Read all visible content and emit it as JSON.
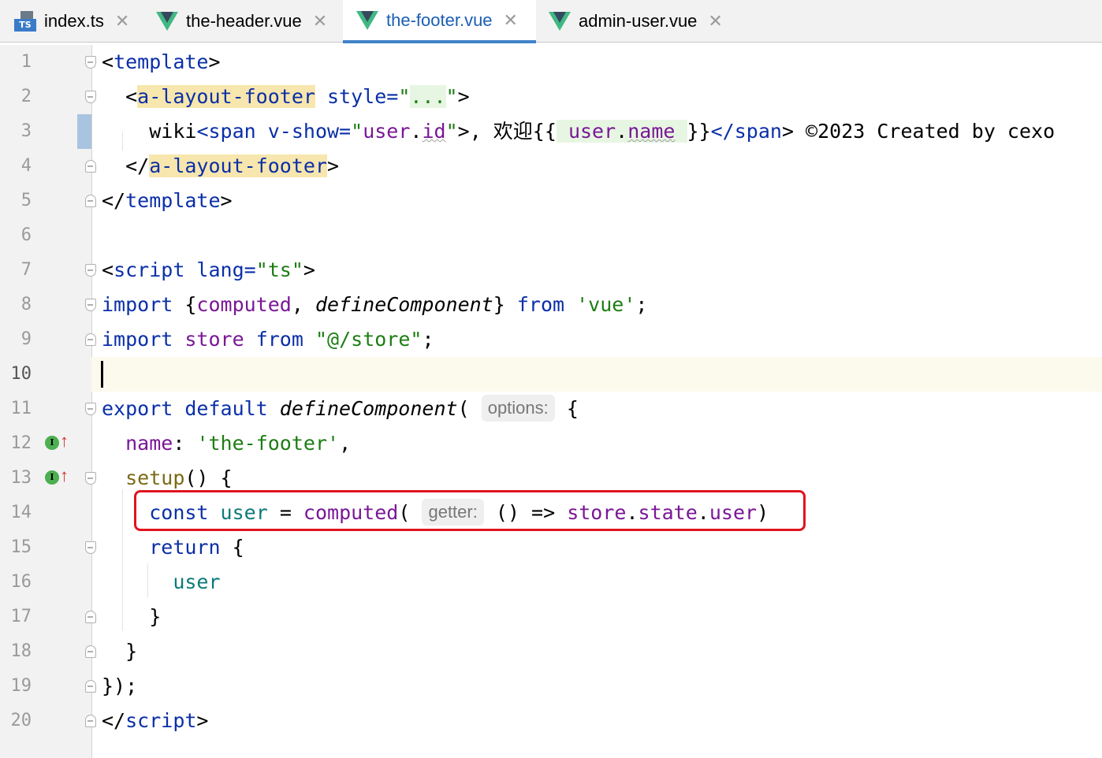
{
  "tabs": [
    {
      "label": "index.ts",
      "icon": "typescript-file-icon",
      "active": false
    },
    {
      "label": "the-header.vue",
      "icon": "vue-file-icon",
      "active": false
    },
    {
      "label": "the-footer.vue",
      "icon": "vue-file-icon",
      "active": true
    },
    {
      "label": "admin-user.vue",
      "icon": "vue-file-icon",
      "active": false
    }
  ],
  "tab_close_glyph": "✕",
  "ts_icon_text": "TS",
  "line_numbers": [
    "1",
    "2",
    "3",
    "4",
    "5",
    "6",
    "7",
    "8",
    "9",
    "10",
    "11",
    "12",
    "13",
    "14",
    "15",
    "16",
    "17",
    "18",
    "19",
    "20"
  ],
  "current_line": 10,
  "colors": {
    "vue_green": "#41b883",
    "accent_blue": "#4083c9",
    "highlight_box": "#e0141e"
  },
  "code": {
    "l1": {
      "t1": "<",
      "t2": "template",
      "t3": ">"
    },
    "l2": {
      "t1": "<",
      "t2": "a-layout-footer",
      "t3": " style=",
      "t4": "\"",
      "t5": "...",
      "t6": "\"",
      "t7": ">"
    },
    "l3": {
      "t1": "wiki",
      "t2": "<span",
      "t3": " v-show=",
      "t4": "\"",
      "t5": "user",
      "t6": ".",
      "t7": "id",
      "t8": "\"",
      "t9": ">, 欢迎{{",
      "t10": " user",
      "t11": ".",
      "t12": "name",
      "t13": " ",
      "t14": "}}",
      "t15": "</span",
      "t16": ">",
      "t17": " ©2023 Created by cexo"
    },
    "l4": {
      "t1": "</",
      "t2": "a-layout-footer",
      "t3": ">"
    },
    "l5": {
      "t1": "</",
      "t2": "template",
      "t3": ">"
    },
    "l7": {
      "t1": "<",
      "t2": "script",
      "t3": " lang=",
      "t4": "\"ts\"",
      "t5": ">"
    },
    "l8": {
      "t1": "import",
      "t2": " {",
      "t3": "computed",
      "t4": ", ",
      "t5": "defineComponent",
      "t6": "} ",
      "t7": "from",
      "t8": " ",
      "t9": "'vue'",
      "t10": ";"
    },
    "l9": {
      "t1": "import",
      "t2": " ",
      "t3": "store",
      "t4": " ",
      "t5": "from",
      "t6": " ",
      "t7": "\"@/store\"",
      "t8": ";"
    },
    "l11": {
      "t1": "export",
      "t2": " ",
      "t3": "default",
      "t4": " ",
      "t5": "defineComponent",
      "t6": "(",
      "hint": "options:",
      "t7": " {"
    },
    "l12": {
      "t1": "name",
      "t2": ": ",
      "t3": "'the-footer'",
      "t4": ","
    },
    "l13": {
      "t1": "setup",
      "t2": "() {"
    },
    "l14": {
      "t1": "const",
      "t2": " ",
      "t3": "user",
      "t4": " = ",
      "t5": "computed",
      "t6": "(",
      "hint": "getter:",
      "t7": " () => ",
      "t8": "store",
      "t9": ".",
      "t10": "state",
      "t11": ".",
      "t12": "user",
      "t13": ")"
    },
    "l15": {
      "t1": "return",
      "t2": " {"
    },
    "l16": {
      "t1": "user"
    },
    "l17": {
      "t1": "}"
    },
    "l18": {
      "t1": "}"
    },
    "l19": {
      "t1": "});"
    },
    "l20": {
      "t1": "</",
      "t2": "script",
      "t3": ">"
    }
  }
}
